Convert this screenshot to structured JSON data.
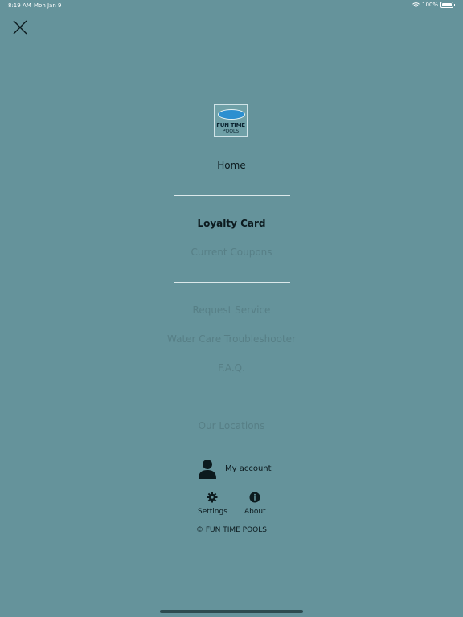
{
  "status_bar": {
    "time": "8:19 AM",
    "date": "Mon Jan 9",
    "battery": "100%",
    "wifi_icon": "wifi-icon",
    "battery_icon": "battery-icon"
  },
  "header": {
    "close_icon": "close-icon"
  },
  "logo": {
    "line1": "FUN TIME",
    "line2": "POOLS"
  },
  "menu": {
    "home": "Home",
    "loyalty_card": "Loyalty Card",
    "current_coupons": "Current Coupons",
    "request_service": "Request Service",
    "water_care": "Water Care Troubleshooter",
    "faq": "F.A.Q.",
    "our_locations": "Our Locations"
  },
  "account": {
    "label": "My account",
    "icon": "user-icon"
  },
  "footer": {
    "settings_label": "Settings",
    "settings_icon": "gear-icon",
    "about_label": "About",
    "about_icon": "info-icon",
    "copyright": "© FUN TIME POOLS"
  },
  "colors": {
    "background": "#65939b",
    "text_dark": "#0c1a1e",
    "text_muted": "#577f86",
    "divider": "#dbe8ea"
  }
}
